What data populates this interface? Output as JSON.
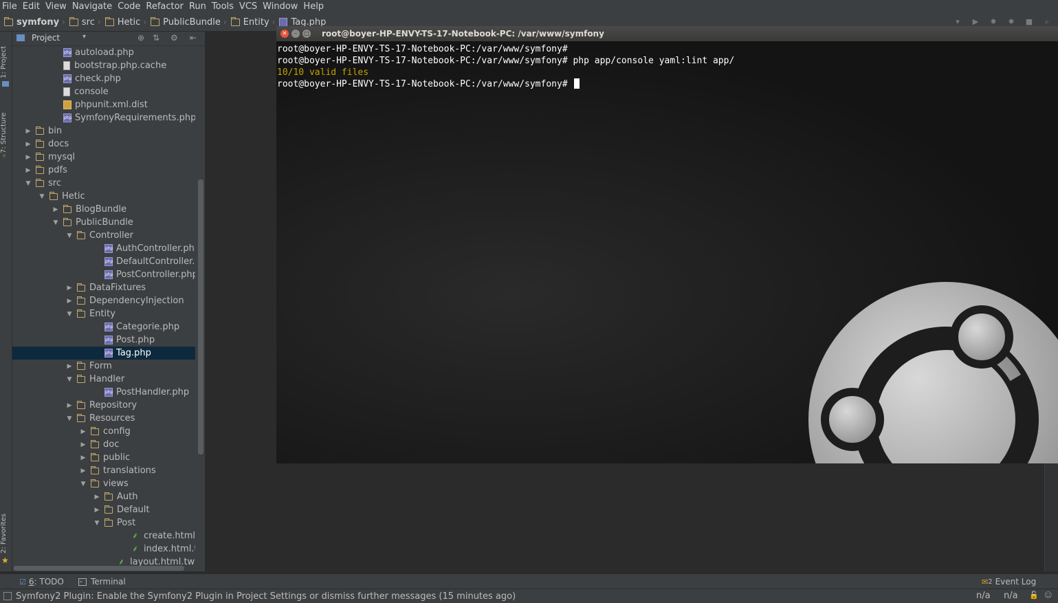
{
  "menu": [
    "File",
    "Edit",
    "View",
    "Navigate",
    "Code",
    "Refactor",
    "Run",
    "Tools",
    "VCS",
    "Window",
    "Help"
  ],
  "breadcrumb": [
    "symfony",
    "src",
    "Hetic",
    "PublicBundle",
    "Entity",
    "Tag.php"
  ],
  "left_strip": {
    "project_tab": "1: Project",
    "structure_tab": "7: Structure",
    "favorites_tab": "2: Favorites"
  },
  "project_panel": {
    "title": "Project"
  },
  "tree": [
    {
      "label": "autoload.php",
      "icon": "php-file-icon",
      "depth": 3,
      "arrow": ""
    },
    {
      "label": "bootstrap.php.cache",
      "icon": "text-file-icon",
      "depth": 3,
      "arrow": ""
    },
    {
      "label": "check.php",
      "icon": "php-file-icon",
      "depth": 3,
      "arrow": ""
    },
    {
      "label": "console",
      "icon": "text-file-icon",
      "depth": 3,
      "arrow": ""
    },
    {
      "label": "phpunit.xml.dist",
      "icon": "xml-file-icon",
      "depth": 3,
      "arrow": ""
    },
    {
      "label": "SymfonyRequirements.php",
      "icon": "php-file-icon",
      "depth": 3,
      "arrow": ""
    },
    {
      "label": "bin",
      "icon": "folder-icon",
      "depth": 1,
      "arrow": "collapsed"
    },
    {
      "label": "docs",
      "icon": "folder-icon",
      "depth": 1,
      "arrow": "collapsed"
    },
    {
      "label": "mysql",
      "icon": "folder-icon",
      "depth": 1,
      "arrow": "collapsed"
    },
    {
      "label": "pdfs",
      "icon": "folder-icon",
      "depth": 1,
      "arrow": "collapsed"
    },
    {
      "label": "src",
      "icon": "folder-icon",
      "depth": 1,
      "arrow": "expanded"
    },
    {
      "label": "Hetic",
      "icon": "folder-icon",
      "depth": 2,
      "arrow": "expanded"
    },
    {
      "label": "BlogBundle",
      "icon": "folder-icon",
      "depth": 3,
      "arrow": "collapsed"
    },
    {
      "label": "PublicBundle",
      "icon": "folder-icon",
      "depth": 3,
      "arrow": "expanded"
    },
    {
      "label": "Controller",
      "icon": "folder-icon",
      "depth": 4,
      "arrow": "expanded"
    },
    {
      "label": "AuthController.php",
      "icon": "php-file-icon",
      "depth": 6,
      "arrow": ""
    },
    {
      "label": "DefaultController.ph",
      "icon": "php-file-icon",
      "depth": 6,
      "arrow": ""
    },
    {
      "label": "PostController.php",
      "icon": "php-file-icon",
      "depth": 6,
      "arrow": ""
    },
    {
      "label": "DataFixtures",
      "icon": "folder-icon",
      "depth": 4,
      "arrow": "collapsed"
    },
    {
      "label": "DependencyInjection",
      "icon": "folder-icon",
      "depth": 4,
      "arrow": "collapsed"
    },
    {
      "label": "Entity",
      "icon": "folder-icon",
      "depth": 4,
      "arrow": "expanded"
    },
    {
      "label": "Categorie.php",
      "icon": "php-file-icon",
      "depth": 6,
      "arrow": ""
    },
    {
      "label": "Post.php",
      "icon": "php-file-icon",
      "depth": 6,
      "arrow": ""
    },
    {
      "label": "Tag.php",
      "icon": "php-file-icon",
      "depth": 6,
      "arrow": "",
      "selected": true
    },
    {
      "label": "Form",
      "icon": "folder-icon",
      "depth": 4,
      "arrow": "collapsed"
    },
    {
      "label": "Handler",
      "icon": "folder-icon",
      "depth": 4,
      "arrow": "expanded"
    },
    {
      "label": "PostHandler.php",
      "icon": "php-file-icon",
      "depth": 6,
      "arrow": ""
    },
    {
      "label": "Repository",
      "icon": "folder-icon",
      "depth": 4,
      "arrow": "collapsed"
    },
    {
      "label": "Resources",
      "icon": "folder-icon",
      "depth": 4,
      "arrow": "expanded"
    },
    {
      "label": "config",
      "icon": "folder-icon",
      "depth": 5,
      "arrow": "collapsed"
    },
    {
      "label": "doc",
      "icon": "folder-icon",
      "depth": 5,
      "arrow": "collapsed"
    },
    {
      "label": "public",
      "icon": "folder-icon",
      "depth": 5,
      "arrow": "collapsed"
    },
    {
      "label": "translations",
      "icon": "folder-icon",
      "depth": 5,
      "arrow": "collapsed"
    },
    {
      "label": "views",
      "icon": "folder-icon",
      "depth": 5,
      "arrow": "expanded"
    },
    {
      "label": "Auth",
      "icon": "folder-icon",
      "depth": 6,
      "arrow": "collapsed"
    },
    {
      "label": "Default",
      "icon": "folder-icon",
      "depth": 6,
      "arrow": "collapsed"
    },
    {
      "label": "Post",
      "icon": "folder-icon",
      "depth": 6,
      "arrow": "expanded"
    },
    {
      "label": "create.html.tw",
      "icon": "twig-file-icon",
      "depth": 8,
      "arrow": ""
    },
    {
      "label": "index.html.twi",
      "icon": "twig-file-icon",
      "depth": 8,
      "arrow": ""
    },
    {
      "label": "layout.html.twig",
      "icon": "twig-file-icon",
      "depth": 7,
      "arrow": ""
    }
  ],
  "terminal": {
    "title": "root@boyer-HP-ENVY-TS-17-Notebook-PC: /var/www/symfony",
    "lines": [
      {
        "text": "root@boyer-HP-ENVY-TS-17-Notebook-PC:/var/www/symfony#",
        "kind": "prompt"
      },
      {
        "text": "root@boyer-HP-ENVY-TS-17-Notebook-PC:/var/www/symfony# php app/console yaml:lint app/",
        "kind": "prompt"
      },
      {
        "text": "10/10 valid files",
        "kind": "ok"
      },
      {
        "text": "root@boyer-HP-ENVY-TS-17-Notebook-PC:/var/www/symfony# ",
        "kind": "prompt-cursor"
      }
    ]
  },
  "bottom_tabs": {
    "todo_num": "6",
    "todo_label": ": TODO",
    "terminal": "Terminal",
    "event_log_count": "2",
    "event_log": "Event Log"
  },
  "status": {
    "message": "Symfony2 Plugin: Enable the Symfony2 Plugin in Project Settings or dismiss further messages (15 minutes ago)",
    "pos1": "n/a",
    "pos2": "n/a"
  },
  "colors": {
    "accent_selection": "#0d293e",
    "prompt_text": "#ffffff",
    "ok_text": "#c4a000",
    "folder": "#c7a96a"
  }
}
